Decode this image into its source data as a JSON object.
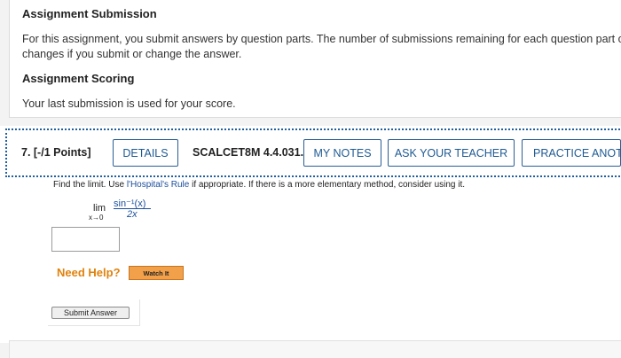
{
  "submission": {
    "heading": "Assignment Submission",
    "line1": "For this assignment, you submit answers by question parts. The number of submissions remaining for each question part only",
    "line2": "changes if you submit or change the answer."
  },
  "scoring": {
    "heading": "Assignment Scoring",
    "text": "Your last submission is used for your score."
  },
  "question": {
    "number_points": "7. [-/1 Points]",
    "buttons": {
      "details": "DETAILS",
      "my_notes": "MY NOTES",
      "ask_teacher": "ASK YOUR TEACHER",
      "practice": "PRACTICE ANOTH"
    },
    "code": "SCALCET8M 4.4.031.",
    "prompt_before": "Find the limit. Use ",
    "prompt_rule": "l'Hospital's Rule",
    "prompt_after": " if appropriate. If there is a more elementary method, consider using it.",
    "limit": {
      "lim": "lim",
      "approach": "x→0",
      "numerator": "sin⁻¹(x)",
      "denominator": "2x"
    },
    "answer_value": "",
    "need_help": "Need Help?",
    "watch_it": "Watch It",
    "submit": "Submit Answer"
  },
  "colors": {
    "accent_blue": "#1e5a92",
    "help_orange": "#e0820e",
    "watch_bg": "#f2a14a"
  }
}
